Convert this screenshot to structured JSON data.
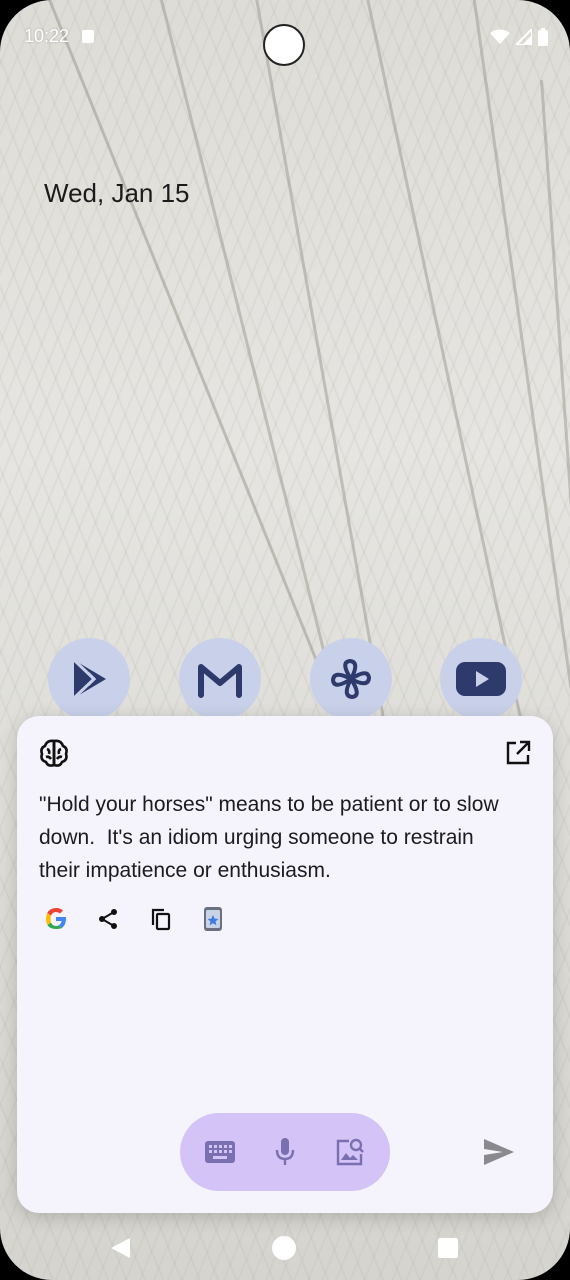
{
  "status_bar": {
    "time": "10:22",
    "notification_icon": "a-icon",
    "wifi_icon": "wifi-icon",
    "signal_icon": "signal-icon",
    "battery_icon": "battery-icon"
  },
  "home": {
    "date": "Wed, Jan 15",
    "apps": [
      {
        "name": "play-store-icon"
      },
      {
        "name": "gmail-icon"
      },
      {
        "name": "pinwheel-icon"
      },
      {
        "name": "youtube-icon"
      }
    ]
  },
  "assistant_panel": {
    "logo_icon": "brain-icon",
    "open_icon": "open-external-icon",
    "answer": "\"Hold your horses\" means to be patient or to slow down.  It's an idiom urging someone to restrain their impatience or enthusiasm.",
    "actions": [
      {
        "icon": "google-icon"
      },
      {
        "icon": "share-icon"
      },
      {
        "icon": "copy-icon"
      },
      {
        "icon": "app-shortcut-icon"
      }
    ],
    "input_modes": [
      {
        "icon": "keyboard-icon"
      },
      {
        "icon": "mic-icon"
      },
      {
        "icon": "image-search-icon"
      }
    ],
    "send_icon": "send-icon",
    "colors": {
      "panel_bg": "#f5f3fb",
      "pill_bg": "#d3c3f7",
      "app_icon_bg": "#c9d1ea",
      "app_icon_fg": "#2e3a6b"
    }
  },
  "nav_bar": {
    "back_icon": "back-icon",
    "home_icon": "home-icon",
    "recents_icon": "recents-icon"
  }
}
